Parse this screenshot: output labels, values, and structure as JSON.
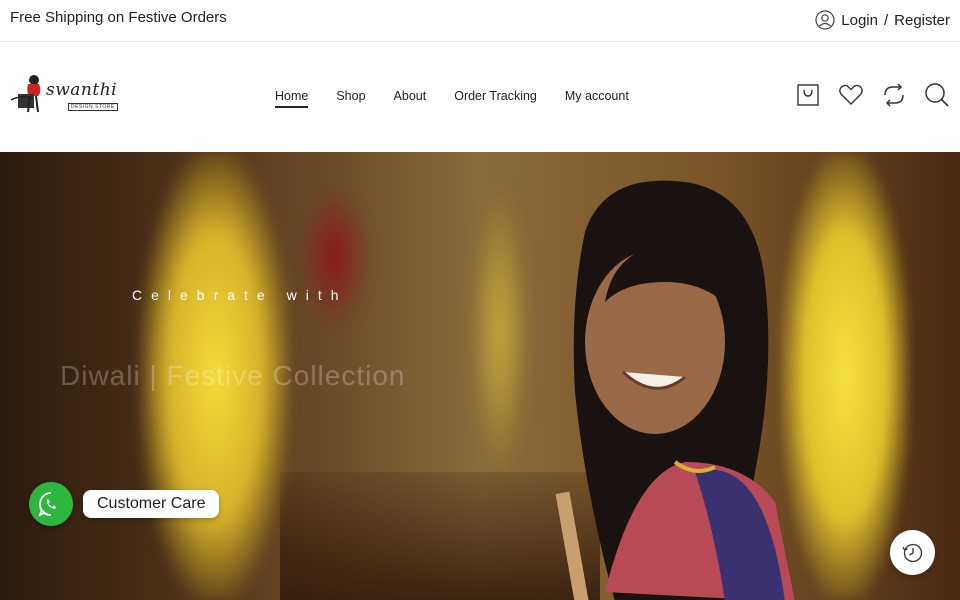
{
  "topbar": {
    "promo": "Free Shipping on Festive Orders",
    "login_label": "Login",
    "separator": "/",
    "register_label": "Register"
  },
  "header": {
    "logo_text": "swanthi",
    "logo_sub": "DESIGN STORE",
    "nav": [
      {
        "label": "Home",
        "active": true
      },
      {
        "label": "Shop"
      },
      {
        "label": "About"
      },
      {
        "label": "Order Tracking"
      },
      {
        "label": "My account"
      }
    ],
    "icons": [
      "cart-icon",
      "heart-icon",
      "compare-icon",
      "search-icon"
    ]
  },
  "hero": {
    "subtitle": "Celebrate with",
    "headline": "Diwali | Festive Collection"
  },
  "care": {
    "label": "Customer Care",
    "icon": "whatsapp-icon"
  },
  "recent": {
    "icon": "history-icon"
  },
  "colors": {
    "whatsapp_green": "#2db742",
    "marigold": "#f4dc3a"
  }
}
